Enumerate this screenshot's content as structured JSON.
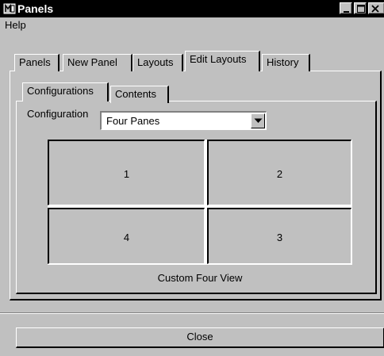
{
  "window": {
    "title": "Panels",
    "icon": "panels-app-icon",
    "controls": [
      "minimize-icon",
      "maximize-icon",
      "close-icon"
    ]
  },
  "menubar": {
    "items": [
      {
        "label": "Help"
      }
    ]
  },
  "tabs": [
    {
      "label": "Panels",
      "active": false
    },
    {
      "label": "New Panel",
      "active": false
    },
    {
      "label": "Layouts",
      "active": false
    },
    {
      "label": "Edit Layouts",
      "active": true
    },
    {
      "label": "History",
      "active": false
    }
  ],
  "edit_layouts": {
    "subtabs": [
      {
        "label": "Configurations",
        "active": true
      },
      {
        "label": "Contents",
        "active": false
      }
    ],
    "configuration_label": "Configuration",
    "configuration_value": "Four Panes",
    "panes": {
      "top_left": "1",
      "top_right": "2",
      "bottom_left": "4",
      "bottom_right": "3"
    },
    "layout_name": "Custom Four View"
  },
  "footer": {
    "close_label": "Close"
  }
}
